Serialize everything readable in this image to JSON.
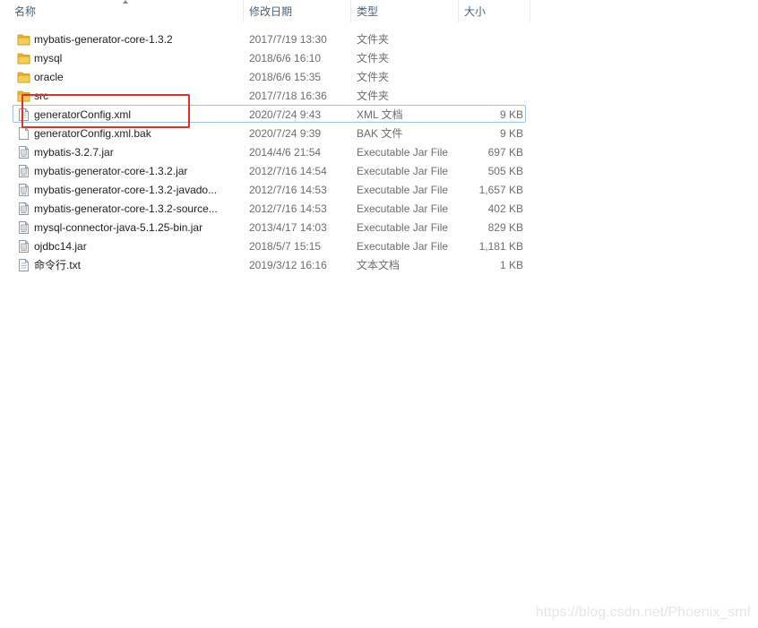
{
  "columns": {
    "name": "名称",
    "date": "修改日期",
    "type": "类型",
    "size": "大小"
  },
  "files": [
    {
      "name": "mybatis-generator-core-1.3.2",
      "date": "2017/7/19 13:30",
      "type": "文件夹",
      "size": "",
      "icon": "folder-icon"
    },
    {
      "name": "mysql",
      "date": "2018/6/6 16:10",
      "type": "文件夹",
      "size": "",
      "icon": "folder-icon"
    },
    {
      "name": "oracle",
      "date": "2018/6/6 15:35",
      "type": "文件夹",
      "size": "",
      "icon": "folder-icon"
    },
    {
      "name": "src",
      "date": "2017/7/18 16:36",
      "type": "文件夹",
      "size": "",
      "icon": "folder-icon"
    },
    {
      "name": "generatorConfig.xml",
      "date": "2020/7/24 9:43",
      "type": "XML 文档",
      "size": "9 KB",
      "icon": "xml-file-icon"
    },
    {
      "name": "generatorConfig.xml.bak",
      "date": "2020/7/24 9:39",
      "type": "BAK 文件",
      "size": "9 KB",
      "icon": "blank-file-icon"
    },
    {
      "name": "mybatis-3.2.7.jar",
      "date": "2014/4/6 21:54",
      "type": "Executable Jar File",
      "size": "697 KB",
      "icon": "jar-file-icon"
    },
    {
      "name": "mybatis-generator-core-1.3.2.jar",
      "date": "2012/7/16 14:54",
      "type": "Executable Jar File",
      "size": "505 KB",
      "icon": "jar-file-icon"
    },
    {
      "name": "mybatis-generator-core-1.3.2-javado...",
      "date": "2012/7/16 14:53",
      "type": "Executable Jar File",
      "size": "1,657 KB",
      "icon": "jar-file-icon"
    },
    {
      "name": "mybatis-generator-core-1.3.2-source...",
      "date": "2012/7/16 14:53",
      "type": "Executable Jar File",
      "size": "402 KB",
      "icon": "jar-file-icon"
    },
    {
      "name": "mysql-connector-java-5.1.25-bin.jar",
      "date": "2013/4/17 14:03",
      "type": "Executable Jar File",
      "size": "829 KB",
      "icon": "jar-file-icon"
    },
    {
      "name": "ojdbc14.jar",
      "date": "2018/5/7 15:15",
      "type": "Executable Jar File",
      "size": "1,181 KB",
      "icon": "jar-file-icon"
    },
    {
      "name": "命令行.txt",
      "date": "2019/3/12 16:16",
      "type": "文本文档",
      "size": "1 KB",
      "icon": "text-file-icon"
    }
  ],
  "selected_index": 4,
  "watermark": "https://blog.csdn.net/Phoenix_smf",
  "colors": {
    "folder": "#e8b730",
    "selection_border": "#99c2e4",
    "annotation": "#e0302a"
  }
}
